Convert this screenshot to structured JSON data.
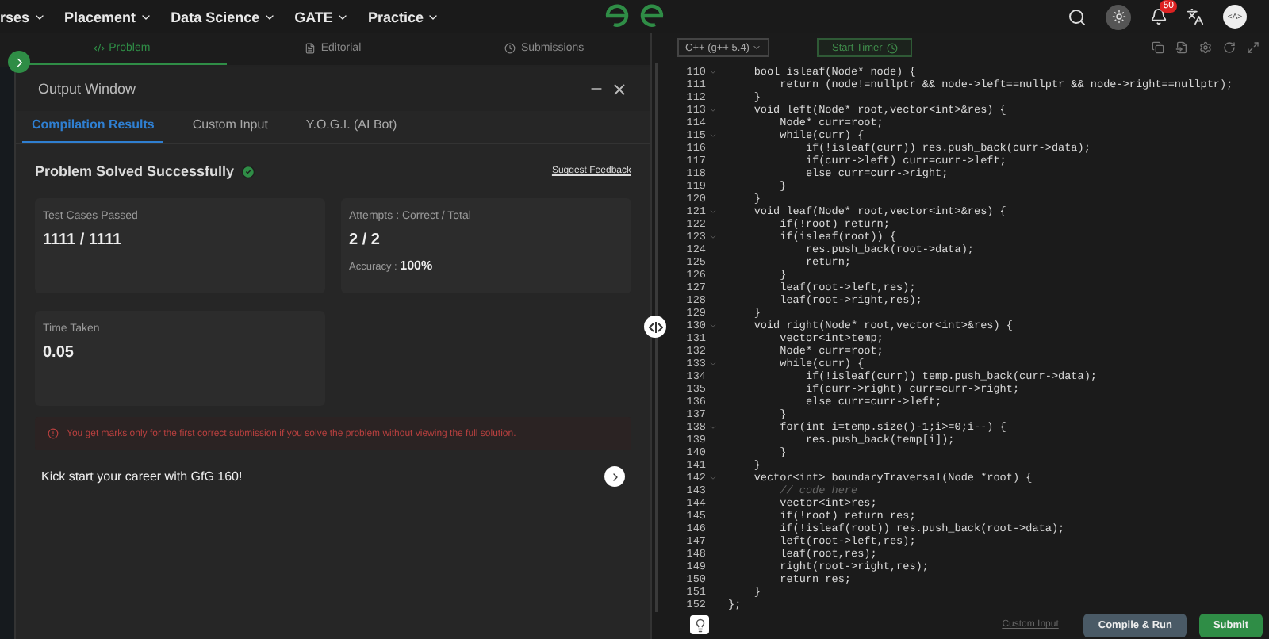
{
  "nav": {
    "items": [
      "rses",
      "Placement",
      "Data Science",
      "GATE",
      "Practice"
    ],
    "notification_count": "50",
    "avatar_text": "<A>"
  },
  "problem_tabs": [
    {
      "label": "Problem",
      "selected": true,
      "kind": "code"
    },
    {
      "label": "Editorial",
      "selected": false,
      "kind": "doc"
    },
    {
      "label": "Submissions",
      "selected": false,
      "kind": "clock"
    }
  ],
  "output_window": {
    "title": "Output Window",
    "tabs": [
      {
        "label": "Compilation Results",
        "selected": true
      },
      {
        "label": "Custom Input",
        "selected": false
      },
      {
        "label": "Y.O.G.I. (AI Bot)",
        "selected": false
      }
    ],
    "status": "Problem Solved Successfully",
    "feedback_link": "Suggest Feedback",
    "cards": [
      {
        "label": "Test Cases Passed",
        "value": "1111 / 1111"
      },
      {
        "label": "Attempts : Correct / Total",
        "value": "2 / 2",
        "sub_label": "Accuracy : ",
        "sub_value": "100%"
      },
      {
        "label": "Time Taken",
        "value": "0.05"
      }
    ],
    "warning": "You get marks only for the first correct submission if you solve the problem without viewing the full solution.",
    "promo": "Kick start your career with GfG 160!"
  },
  "editor": {
    "language": "C++ (g++ 5.4)",
    "timer_button": "Start Timer",
    "lines": [
      {
        "number": "110",
        "code": "    bool isleaf(Node* node) {",
        "foldable": true,
        "kind": "code"
      },
      {
        "number": "111",
        "code": "        return (node!=nullptr && node->left==nullptr && node->right==nullptr);",
        "foldable": false,
        "kind": "code"
      },
      {
        "number": "112",
        "code": "    }",
        "foldable": false,
        "kind": "code"
      },
      {
        "number": "113",
        "code": "    void left(Node* root,vector<int>&res) {",
        "foldable": true,
        "kind": "code"
      },
      {
        "number": "114",
        "code": "        Node* curr=root;",
        "foldable": false,
        "kind": "code"
      },
      {
        "number": "115",
        "code": "        while(curr) {",
        "foldable": true,
        "kind": "code"
      },
      {
        "number": "116",
        "code": "            if(!isleaf(curr)) res.push_back(curr->data);",
        "foldable": false,
        "kind": "code"
      },
      {
        "number": "117",
        "code": "            if(curr->left) curr=curr->left;",
        "foldable": false,
        "kind": "code"
      },
      {
        "number": "118",
        "code": "            else curr=curr->right;",
        "foldable": false,
        "kind": "code"
      },
      {
        "number": "119",
        "code": "        }",
        "foldable": false,
        "kind": "code"
      },
      {
        "number": "120",
        "code": "    }",
        "foldable": false,
        "kind": "code"
      },
      {
        "number": "121",
        "code": "    void leaf(Node* root,vector<int>&res) {",
        "foldable": true,
        "kind": "code"
      },
      {
        "number": "122",
        "code": "        if(!root) return;",
        "foldable": false,
        "kind": "code"
      },
      {
        "number": "123",
        "code": "        if(isleaf(root)) {",
        "foldable": true,
        "kind": "code"
      },
      {
        "number": "124",
        "code": "            res.push_back(root->data);",
        "foldable": false,
        "kind": "code"
      },
      {
        "number": "125",
        "code": "            return;",
        "foldable": false,
        "kind": "code"
      },
      {
        "number": "126",
        "code": "        }",
        "foldable": false,
        "kind": "code"
      },
      {
        "number": "127",
        "code": "        leaf(root->left,res);",
        "foldable": false,
        "kind": "code"
      },
      {
        "number": "128",
        "code": "        leaf(root->right,res);",
        "foldable": false,
        "kind": "code"
      },
      {
        "number": "129",
        "code": "    }",
        "foldable": false,
        "kind": "code"
      },
      {
        "number": "130",
        "code": "    void right(Node* root,vector<int>&res) {",
        "foldable": true,
        "kind": "code"
      },
      {
        "number": "131",
        "code": "        vector<int>temp;",
        "foldable": false,
        "kind": "code"
      },
      {
        "number": "132",
        "code": "        Node* curr=root;",
        "foldable": false,
        "kind": "code"
      },
      {
        "number": "133",
        "code": "        while(curr) {",
        "foldable": true,
        "kind": "code"
      },
      {
        "number": "134",
        "code": "            if(!isleaf(curr)) temp.push_back(curr->data);",
        "foldable": false,
        "kind": "code"
      },
      {
        "number": "135",
        "code": "            if(curr->right) curr=curr->right;",
        "foldable": false,
        "kind": "code"
      },
      {
        "number": "136",
        "code": "            else curr=curr->left;",
        "foldable": false,
        "kind": "code"
      },
      {
        "number": "137",
        "code": "        }",
        "foldable": false,
        "kind": "code"
      },
      {
        "number": "138",
        "code": "        for(int i=temp.size()-1;i>=0;i--) {",
        "foldable": true,
        "kind": "code"
      },
      {
        "number": "139",
        "code": "            res.push_back(temp[i]);",
        "foldable": false,
        "kind": "code"
      },
      {
        "number": "140",
        "code": "        }",
        "foldable": false,
        "kind": "code"
      },
      {
        "number": "141",
        "code": "    }",
        "foldable": false,
        "kind": "code"
      },
      {
        "number": "142",
        "code": "    vector<int> boundaryTraversal(Node *root) {",
        "foldable": true,
        "kind": "code"
      },
      {
        "number": "143",
        "code": "        // code here",
        "foldable": false,
        "kind": "comment"
      },
      {
        "number": "144",
        "code": "        vector<int>res;",
        "foldable": false,
        "kind": "code"
      },
      {
        "number": "145",
        "code": "        if(!root) return res;",
        "foldable": false,
        "kind": "code"
      },
      {
        "number": "146",
        "code": "        if(!isleaf(root)) res.push_back(root->data);",
        "foldable": false,
        "kind": "code"
      },
      {
        "number": "147",
        "code": "        left(root->left,res);",
        "foldable": false,
        "kind": "code"
      },
      {
        "number": "148",
        "code": "        leaf(root,res);",
        "foldable": false,
        "kind": "code"
      },
      {
        "number": "149",
        "code": "        right(root->right,res);",
        "foldable": false,
        "kind": "code"
      },
      {
        "number": "150",
        "code": "        return res;",
        "foldable": false,
        "kind": "code"
      },
      {
        "number": "151",
        "code": "    }",
        "foldable": false,
        "kind": "code"
      },
      {
        "number": "152",
        "code": "};",
        "foldable": false,
        "kind": "code"
      }
    ],
    "custom_input_link": "Custom Input",
    "compile_button": "Compile & Run",
    "submit_button": "Submit"
  }
}
